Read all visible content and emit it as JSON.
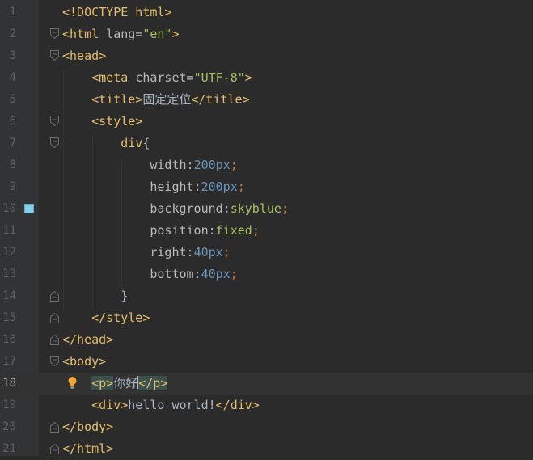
{
  "editor": {
    "language": "HTML",
    "current_line": 18,
    "lines": [
      {
        "n": "1",
        "tokens": [
          {
            "t": "<!DOCTYPE html>",
            "c": "tag"
          }
        ]
      },
      {
        "n": "2",
        "tokens": [
          {
            "t": "<html ",
            "c": "tag"
          },
          {
            "t": "lang",
            "c": "attr"
          },
          {
            "t": "=",
            "c": "attr"
          },
          {
            "t": "\"en\"",
            "c": "str"
          },
          {
            "t": ">",
            "c": "tag"
          }
        ]
      },
      {
        "n": "3",
        "tokens": [
          {
            "t": "<head>",
            "c": "tag"
          }
        ]
      },
      {
        "n": "4",
        "tokens": [
          {
            "t": "    <meta ",
            "c": "tag"
          },
          {
            "t": "charset",
            "c": "attr"
          },
          {
            "t": "=",
            "c": "attr"
          },
          {
            "t": "\"UTF-8\"",
            "c": "str"
          },
          {
            "t": ">",
            "c": "tag"
          }
        ]
      },
      {
        "n": "5",
        "tokens": [
          {
            "t": "    <title>",
            "c": "tag"
          },
          {
            "t": "固定定位",
            "c": "plain"
          },
          {
            "t": "</title>",
            "c": "tag"
          }
        ]
      },
      {
        "n": "6",
        "tokens": [
          {
            "t": "    <style>",
            "c": "tag"
          }
        ]
      },
      {
        "n": "7",
        "tokens": [
          {
            "t": "        div",
            "c": "sel"
          },
          {
            "t": "{",
            "c": "plain"
          }
        ]
      },
      {
        "n": "8",
        "tokens": [
          {
            "t": "            width",
            "c": "prop"
          },
          {
            "t": ":",
            "c": "plain"
          },
          {
            "t": "200px",
            "c": "num"
          },
          {
            "t": ";",
            "c": "punct"
          }
        ]
      },
      {
        "n": "9",
        "tokens": [
          {
            "t": "            height",
            "c": "prop"
          },
          {
            "t": ":",
            "c": "plain"
          },
          {
            "t": "200px",
            "c": "num"
          },
          {
            "t": ";",
            "c": "punct"
          }
        ]
      },
      {
        "n": "10",
        "tokens": [
          {
            "t": "            background",
            "c": "prop"
          },
          {
            "t": ":",
            "c": "plain"
          },
          {
            "t": "skyblue",
            "c": "val"
          },
          {
            "t": ";",
            "c": "punct"
          }
        ]
      },
      {
        "n": "11",
        "tokens": [
          {
            "t": "            position",
            "c": "prop"
          },
          {
            "t": ":",
            "c": "plain"
          },
          {
            "t": "fixed",
            "c": "val"
          },
          {
            "t": ";",
            "c": "punct"
          }
        ]
      },
      {
        "n": "12",
        "tokens": [
          {
            "t": "            right",
            "c": "prop"
          },
          {
            "t": ":",
            "c": "plain"
          },
          {
            "t": "40px",
            "c": "num"
          },
          {
            "t": ";",
            "c": "punct"
          }
        ]
      },
      {
        "n": "13",
        "tokens": [
          {
            "t": "            bottom",
            "c": "prop"
          },
          {
            "t": ":",
            "c": "plain"
          },
          {
            "t": "40px",
            "c": "num"
          },
          {
            "t": ";",
            "c": "punct"
          }
        ]
      },
      {
        "n": "14",
        "tokens": [
          {
            "t": "        }",
            "c": "plain"
          }
        ]
      },
      {
        "n": "15",
        "tokens": [
          {
            "t": "    </style>",
            "c": "tag"
          }
        ]
      },
      {
        "n": "16",
        "tokens": [
          {
            "t": "</head>",
            "c": "tag"
          }
        ]
      },
      {
        "n": "17",
        "tokens": [
          {
            "t": "<body>",
            "c": "tag"
          }
        ]
      },
      {
        "n": "18",
        "tokens": [
          {
            "t": "    ",
            "c": "plain"
          },
          {
            "t": "<p>",
            "c": "tagmatch"
          },
          {
            "t": "你好",
            "c": "plain"
          },
          {
            "t": "|caret|",
            "c": "caret"
          },
          {
            "t": "</p>",
            "c": "tagmatch"
          }
        ]
      },
      {
        "n": "19",
        "tokens": [
          {
            "t": "    <div>",
            "c": "tag"
          },
          {
            "t": "hello world!",
            "c": "plain"
          },
          {
            "t": "</div>",
            "c": "tag"
          }
        ]
      },
      {
        "n": "20",
        "tokens": [
          {
            "t": "</body>",
            "c": "tag"
          }
        ]
      },
      {
        "n": "21",
        "tokens": [
          {
            "t": "</html>",
            "c": "tag"
          }
        ]
      }
    ],
    "fold_open": [
      "2",
      "3",
      "6",
      "7"
    ],
    "fold_close": [
      "14",
      "15",
      "16",
      "20",
      "21"
    ],
    "fold_open_after_17": [
      "17"
    ],
    "bookmark_line": "10",
    "intention_bulb_line": "18",
    "icons": {
      "fold": "fold-marker-icon",
      "bookmark": "bookmark-icon",
      "bulb": "intention-bulb-icon"
    }
  }
}
